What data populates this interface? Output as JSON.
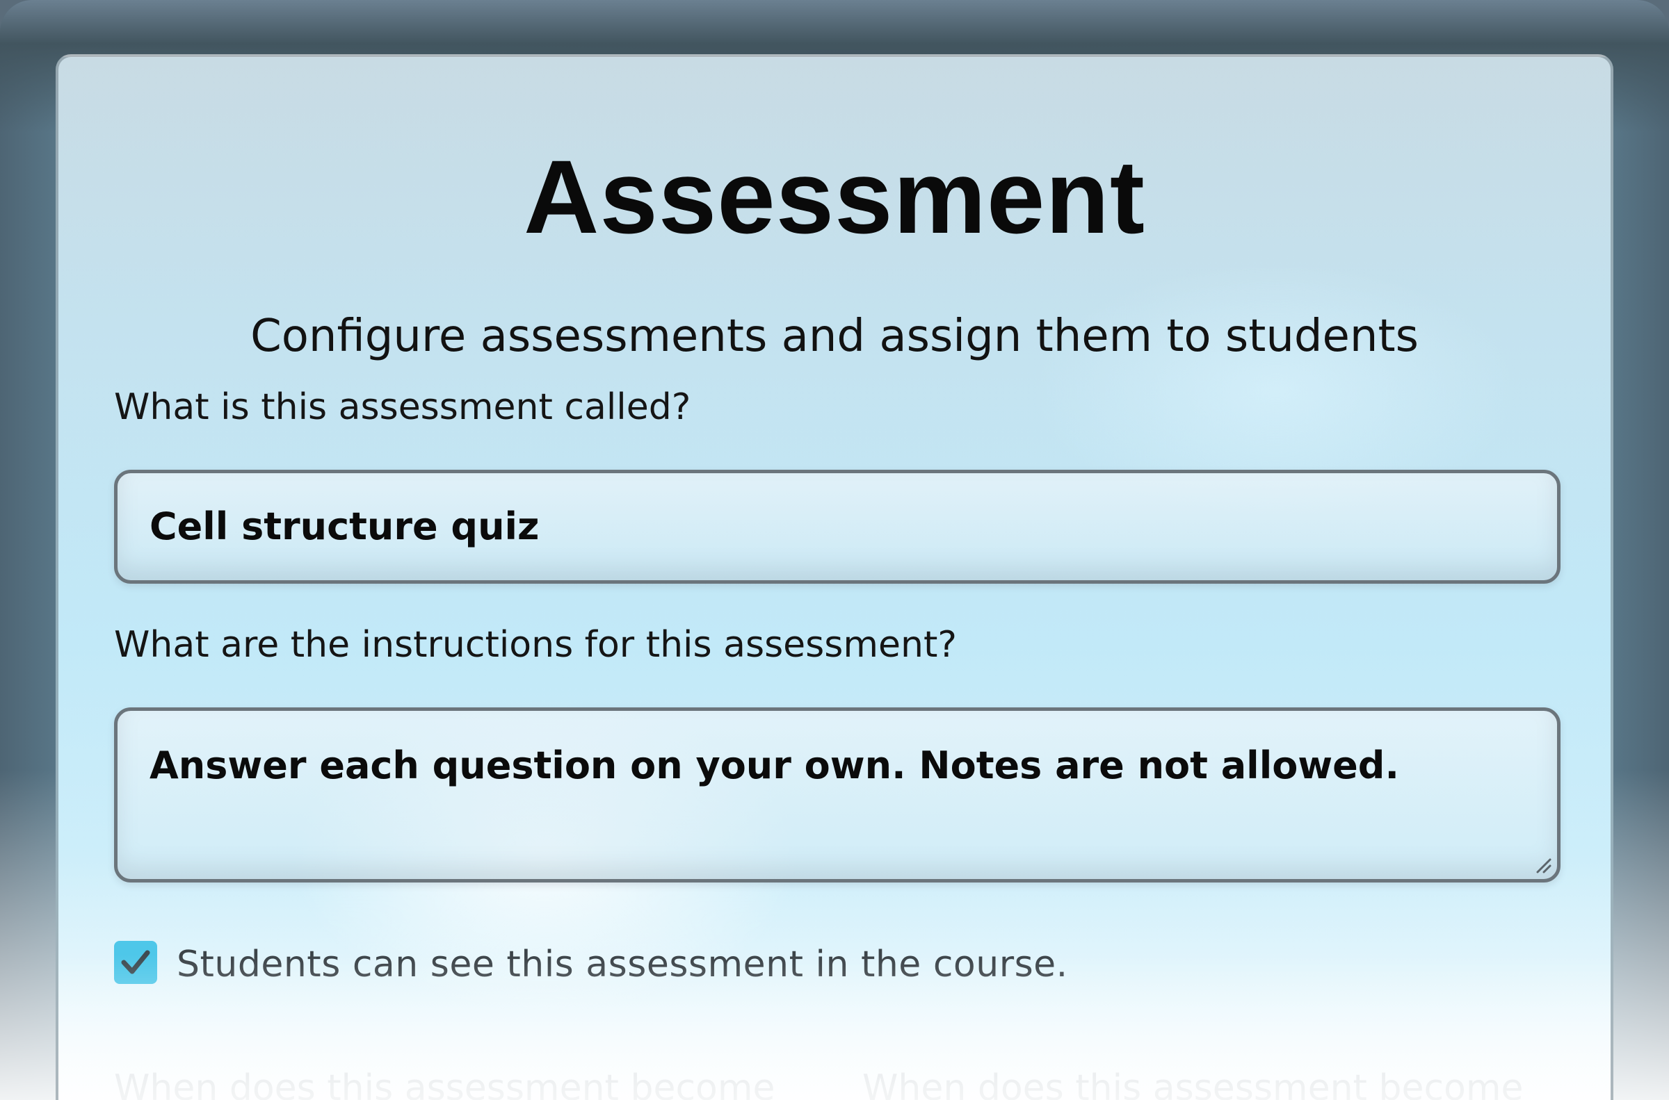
{
  "page": {
    "title": "Assessment",
    "subtitle": "Configure assessments and assign them to students"
  },
  "form": {
    "name_label": "What is this assessment called?",
    "name_value": "Cell structure quiz",
    "instructions_label": "What are the instructions for this assessment?",
    "instructions_value": "Answer each question on your own. Notes are not allowed.",
    "visible_checked": true,
    "visible_label": "Students can see this assessment in the course.",
    "available_from_label": "When does this assessment become",
    "available_until_label": "When does this assessment become"
  },
  "colors": {
    "checkbox_accent": "#4ec7e9",
    "input_border": "#6b757c"
  },
  "icons": {
    "checkbox": "checkmark-icon",
    "resize": "resize-grip-icon"
  }
}
